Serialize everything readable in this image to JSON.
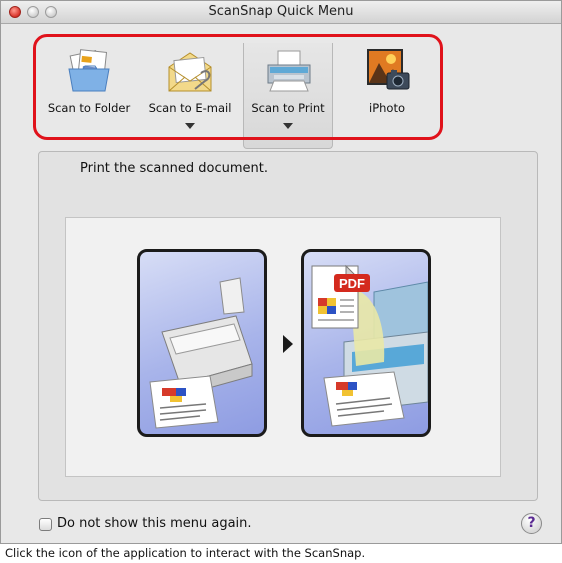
{
  "window": {
    "title": "ScanSnap Quick Menu"
  },
  "apps": [
    {
      "label": "Scan to Folder",
      "icon": "folder-icon"
    },
    {
      "label": "Scan to E-mail",
      "icon": "email-icon",
      "has_menu": true
    },
    {
      "label": "Scan to Print",
      "icon": "printer-icon",
      "has_menu": true,
      "selected": true
    },
    {
      "label": "iPhoto",
      "icon": "iphoto-icon"
    }
  ],
  "description": "Print the scanned document.",
  "illustration": {
    "pdf_label": "PDF"
  },
  "checkbox": {
    "label": "Do not show this menu again.",
    "checked": false
  },
  "help": {
    "label": "?"
  },
  "status": "Click the icon of the application to interact with the ScanSnap.",
  "colors": {
    "highlight": "#e0121b",
    "card_blue": "#a8b4ea",
    "pdf_red": "#d42a1e"
  }
}
